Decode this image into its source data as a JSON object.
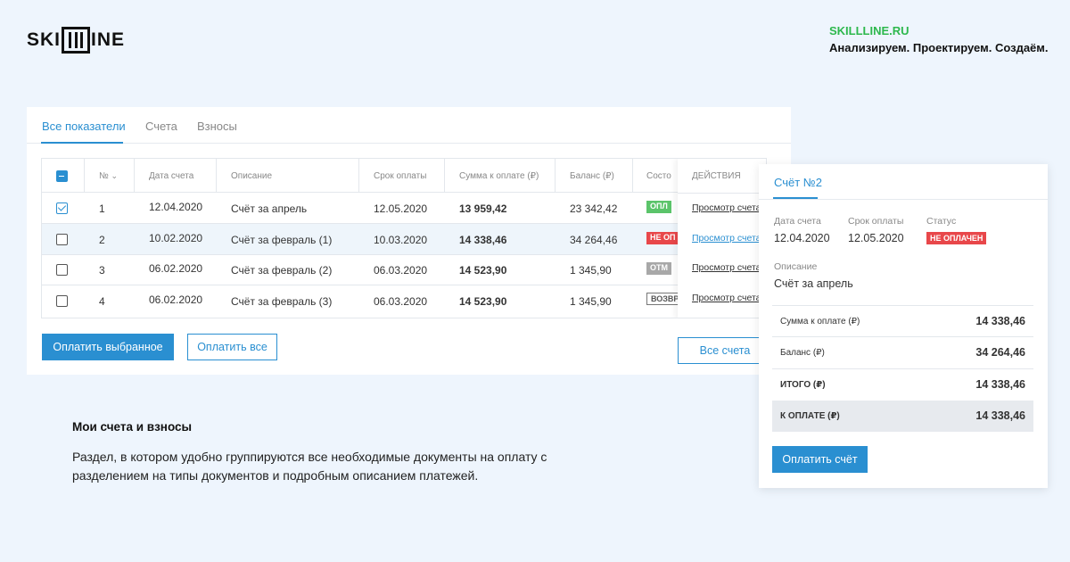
{
  "header": {
    "logo_text_left": "SKI",
    "logo_text_right": "INE",
    "site_url": "SKILLLINE.RU",
    "slogan": "Анализируем. Проектируем. Создаём."
  },
  "tabs": [
    "Все показатели",
    "Счета",
    "Взносы"
  ],
  "table": {
    "columns": [
      "№",
      "Дата счета",
      "Описание",
      "Срок оплаты",
      "Сумма к оплате (₽)",
      "Баланс (₽)",
      "Состо",
      "ДЕЙСТВИЯ"
    ],
    "rows": [
      {
        "num": "1",
        "date": "12.04.2020",
        "desc": "Счёт за апрель",
        "due": "12.05.2020",
        "sum": "13 959,42",
        "balance": "23 342,42",
        "status": "ОПЛ",
        "action": "Просмотр счета",
        "checked": true
      },
      {
        "num": "2",
        "date": "10.02.2020",
        "desc": "Счёт за февраль (1)",
        "due": "10.03.2020",
        "sum": "14 338,46",
        "balance": "34 264,46",
        "status": "НЕ ОП",
        "action": "Просмотр счета",
        "checked": false
      },
      {
        "num": "3",
        "date": "06.02.2020",
        "desc": "Счёт за февраль (2)",
        "due": "06.03.2020",
        "sum": "14 523,90",
        "balance": "1 345,90",
        "status": "ОТМ",
        "action": "Просмотр счета",
        "checked": false
      },
      {
        "num": "4",
        "date": "06.02.2020",
        "desc": "Счёт за февраль (3)",
        "due": "06.03.2020",
        "sum": "14 523,90",
        "balance": "1 345,90",
        "status": "ВОЗВР",
        "action": "Просмотр счета",
        "checked": false
      }
    ]
  },
  "buttons": {
    "pay_selected": "Оплатить выбранное",
    "pay_all": "Оплатить все",
    "all_invoices": "Все счета"
  },
  "description": {
    "title": "Мои счета и взносы",
    "text": "Раздел, в котором удобно группируются все необходимые документы на оплату с разделением на типы документов и подробным описанием платежей."
  },
  "panel": {
    "title": "Счёт №2",
    "date_label": "Дата счета",
    "date_value": "12.04.2020",
    "due_label": "Срок оплаты",
    "due_value": "12.05.2020",
    "status_label": "Статус",
    "status_value": "НЕ ОПЛАЧЕН",
    "desc_label": "Описание",
    "desc_value": "Счёт за апрель",
    "sums": [
      {
        "label": "Сумма к оплате (₽)",
        "value": "14 338,46"
      },
      {
        "label": "Баланс (₽)",
        "value": "34 264,46"
      },
      {
        "label": "ИТОГО (₽)",
        "value": "14 338,46"
      },
      {
        "label": "К ОПЛАТЕ (₽)",
        "value": "14 338,46"
      }
    ],
    "pay_button": "Оплатить счёт"
  },
  "colors": {
    "accent": "#2a8fd1",
    "brand_green": "#2db84d",
    "paid": "#5bc46a",
    "unpaid": "#e8474a",
    "cancelled": "#a8a8a8",
    "background": "#eef5fd"
  }
}
